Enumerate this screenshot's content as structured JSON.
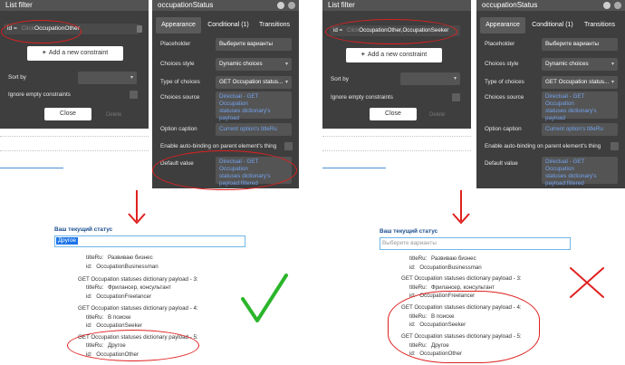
{
  "list_filter": {
    "title": "List filter",
    "left_expr": {
      "prefix": "id =",
      "kw": "Click",
      "val": "OccupationOther"
    },
    "right_expr": {
      "prefix": "id =",
      "kw": "Click",
      "val": "OccupationOther,OccupationSeeker"
    },
    "add_label": "Add a new constraint",
    "sort_label": "Sort by",
    "ignore_label": "Ignore empty constraints",
    "close_label": "Close",
    "delete_label": "Delete"
  },
  "occ_panel": {
    "title": "occupationStatus",
    "tabs": [
      "Appearance",
      "Conditional (1)",
      "Transitions"
    ],
    "placeholder_label": "Placeholder",
    "placeholder_value": "Выберите варианты",
    "style_label": "Choices style",
    "style_value": "Dynamic choices",
    "type_label": "Type of choices",
    "type_value": "GET Occupation status...",
    "source_label": "Choices source",
    "source_value": [
      "Directual - GET Occupation",
      "statuses dictionary's",
      "payload"
    ],
    "caption_label": "Option caption",
    "caption_value": "Current option's titleRu",
    "autobind_label": "Enable auto-binding on parent element's thing",
    "default_label": "Default value",
    "default_value": [
      "Directual - GET Occupation",
      "statuses dictionary's",
      "payload:filtered"
    ]
  },
  "preview": {
    "heading": "Ваш текущий статус",
    "left_selected": "Другое",
    "right_placeholder": "Выберите варианты",
    "left_list": [
      [
        "titleRu:",
        "Развиваю бизнес"
      ],
      [
        "id:",
        "OccupationBusinessman"
      ],
      [
        "GET Occupation statuses dictionary payload - 3:"
      ],
      [
        "titleRu:",
        "Фрилансер, консультант"
      ],
      [
        "id:",
        "OccupationFreelancer"
      ],
      [
        "GET Occupation statuses dictionary payload - 4:"
      ],
      [
        "titleRu:",
        "В поиске"
      ],
      [
        "id:",
        "OccupationSeeker"
      ],
      [
        "GET Occupation statuses dictionary payload - 5:"
      ],
      [
        "titleRu:",
        "Другое"
      ],
      [
        "id:",
        "OccupationOther"
      ]
    ],
    "right_list": [
      [
        "titleRu:",
        "Развиваю бизнес"
      ],
      [
        "id:",
        "OccupationBusinessman"
      ],
      [
        "GET Occupation statuses dictionary payload - 3:"
      ],
      [
        "titleRu:",
        "Фрилансер, консультант"
      ],
      [
        "id:",
        "OccupationFreelancer"
      ],
      [
        "GET Occupation statuses dictionary payload - 4:"
      ],
      [
        "titleRu:",
        "В поиске"
      ],
      [
        "id:",
        "OccupationSeeker"
      ],
      [
        "GET Occupation statuses dictionary payload - 5:"
      ],
      [
        "titleRu:",
        "Другое"
      ],
      [
        "id:",
        "OccupationOther"
      ]
    ]
  },
  "colors": {
    "annotation": "#e02020",
    "check": "#2bb52b",
    "link": "#74a4f0"
  },
  "icons": [
    "info-icon",
    "comment-icon",
    "trash-icon",
    "plus-icon",
    "down-arrow-icon",
    "check-mark-icon",
    "cross-mark-icon"
  ]
}
